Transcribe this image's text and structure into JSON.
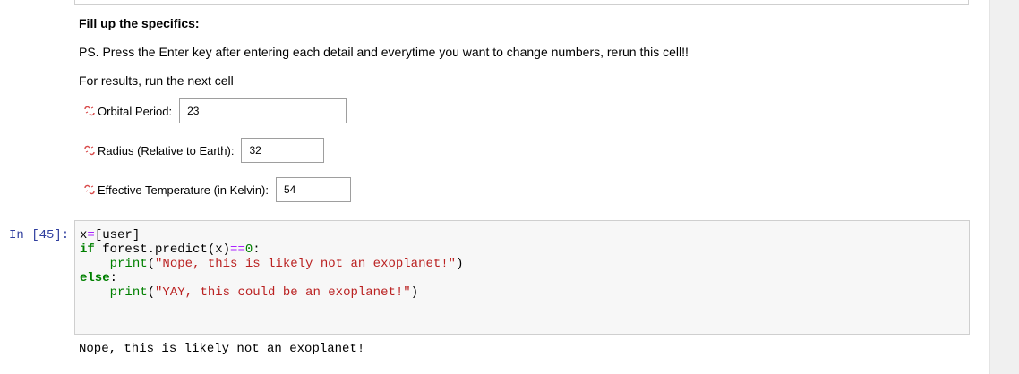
{
  "markdown": {
    "heading": "Fill up the specifics:",
    "note": "PS. Press the Enter key after entering each detail and everytime you want to change numbers, rerun this cell!!",
    "results_hint": "For results, run the next cell"
  },
  "widgets": [
    {
      "label": "Orbital Period:",
      "value": "23"
    },
    {
      "label": "Radius (Relative to Earth):",
      "value": "32"
    },
    {
      "label": "Effective Temperature (in Kelvin):",
      "value": "54"
    }
  ],
  "link_icon": "unlinked-chain-icon",
  "code_cell": {
    "prompt": "In [45]:",
    "line1_var": "x",
    "line1_op": "=",
    "line1_rest": "[user]",
    "line2_kw": "if",
    "line2_obj": " forest.predict(x)",
    "line2_op": "==",
    "line2_num": "0",
    "line2_colon": ":",
    "line3_indent": "    ",
    "line3_fn": "print",
    "line3_open": "(",
    "line3_str": "\"Nope, this is likely not an exoplanet!\"",
    "line3_close": ")",
    "line4_kw": "else",
    "line4_colon": ":",
    "line5_indent": "    ",
    "line5_fn": "print",
    "line5_open": "(",
    "line5_str": "\"YAY, this could be an exoplanet!\"",
    "line5_close": ")"
  },
  "output": {
    "text": "Nope, this is likely not an exoplanet!"
  },
  "colors": {
    "prompt": "#303f9f",
    "keyword": "#008000",
    "string": "#ba2121",
    "operator": "#aa22ff",
    "link_icon": "#d84a4a"
  }
}
